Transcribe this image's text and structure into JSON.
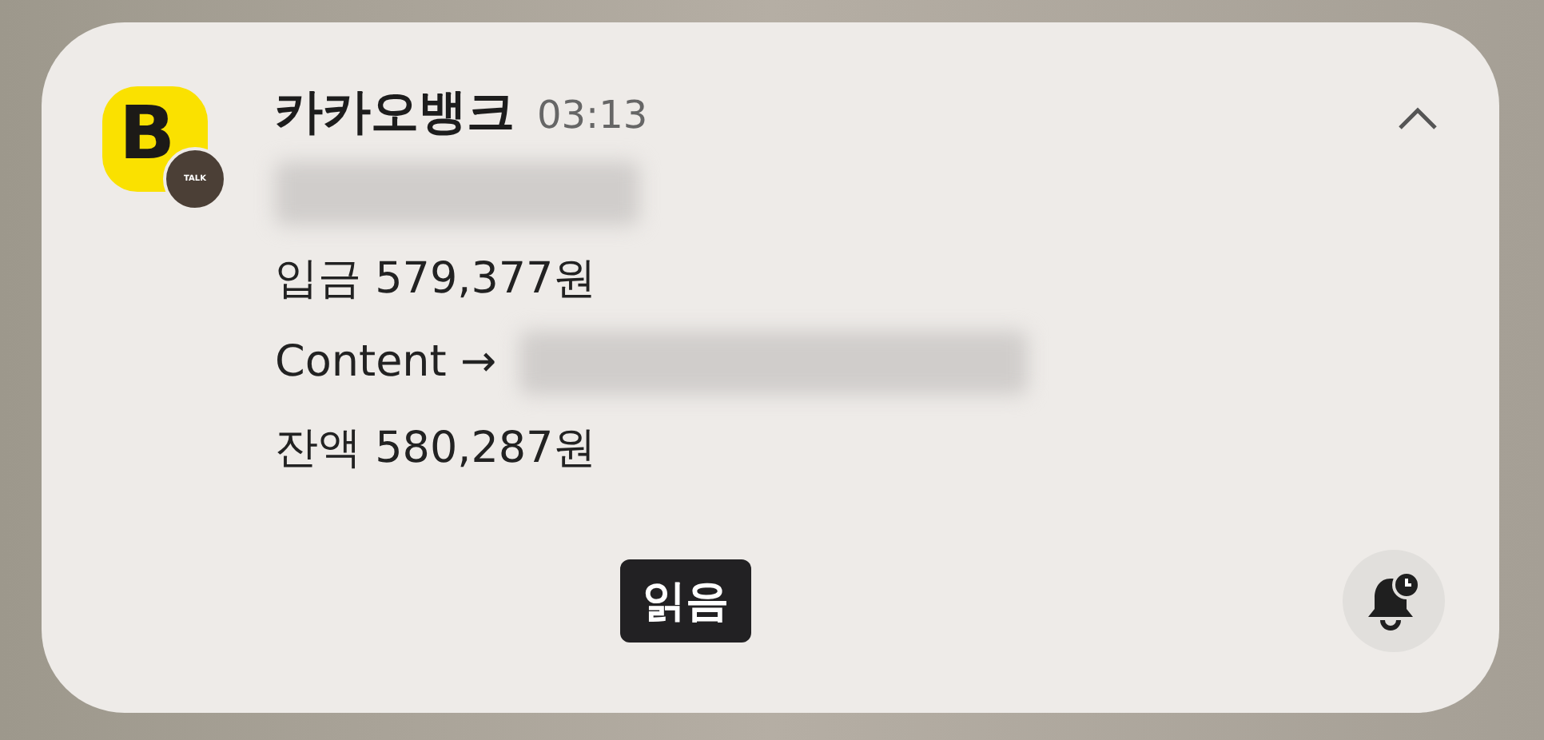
{
  "notification": {
    "logo": {
      "letter": "B",
      "badge": "TALK"
    },
    "app_name": "카카오뱅크",
    "time": "03:13",
    "expanded": true,
    "lines": [
      {
        "kind": "redacted"
      },
      {
        "kind": "text",
        "text": "입금 579,377원"
      },
      {
        "kind": "text-redacted",
        "text": "Content →"
      },
      {
        "kind": "text",
        "text": "잔액 580,287원"
      }
    ],
    "action": {
      "label": "읽음"
    }
  }
}
